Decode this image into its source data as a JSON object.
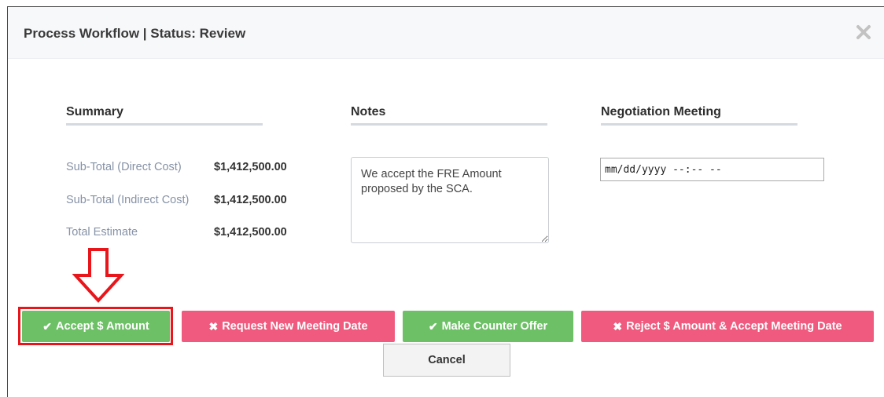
{
  "modal": {
    "title": "Process Workflow | Status: Review",
    "close_icon": "close-icon"
  },
  "summary": {
    "heading": "Summary",
    "rows": [
      {
        "label": "Sub-Total (Direct Cost)",
        "value": "$1,412,500.00"
      },
      {
        "label": "Sub-Total (Indirect Cost)",
        "value": "$1,412,500.00"
      },
      {
        "label": "Total Estimate",
        "value": "$1,412,500.00"
      }
    ]
  },
  "notes": {
    "heading": "Notes",
    "value": "We accept the FRE Amount proposed by the SCA."
  },
  "meeting": {
    "heading": "Negotiation Meeting",
    "value": "mm/dd/yyyy --:-- --"
  },
  "actions": {
    "accept_label": "Accept $ Amount",
    "request_label": "Request New Meeting Date",
    "counter_label": "Make Counter Offer",
    "reject_label": "Reject $ Amount & Accept Meeting Date",
    "cancel_label": "Cancel",
    "check_icon": "✔",
    "x_icon": "✖"
  },
  "colors": {
    "accept_green": "#6dc066",
    "reject_pink": "#ef5a7e",
    "highlight_red": "#e8161b"
  }
}
